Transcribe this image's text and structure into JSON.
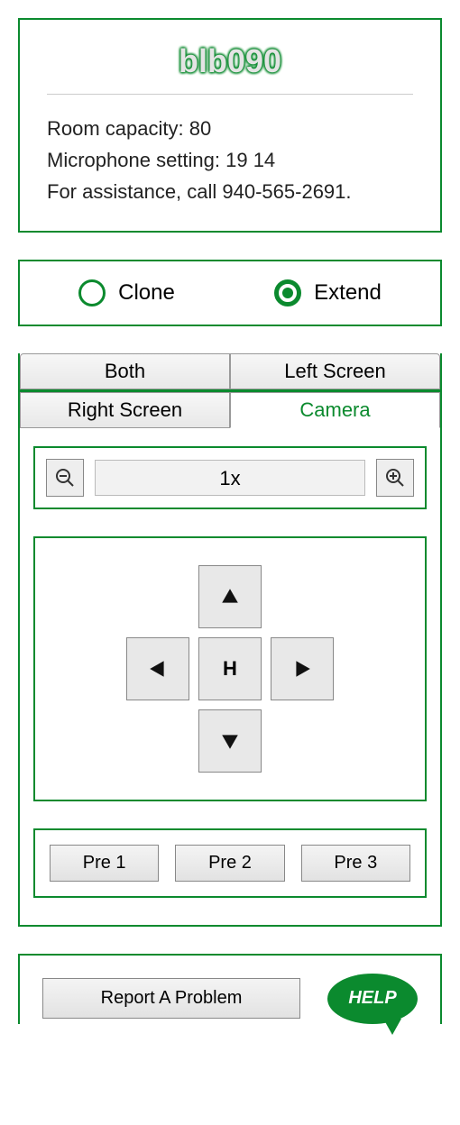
{
  "room": {
    "title": "blb090",
    "capacity_line": "Room capacity: 80",
    "mic_line": "Microphone setting: 19 14",
    "assist_line": "For assistance, call 940-565-2691."
  },
  "displayMode": {
    "clone": "Clone",
    "extend": "Extend",
    "selected": "extend"
  },
  "tabs": {
    "both": "Both",
    "left": "Left Screen",
    "right": "Right Screen",
    "camera": "Camera",
    "active": "camera"
  },
  "zoom": {
    "display": "1x"
  },
  "dpad": {
    "home": "H"
  },
  "presets": {
    "p1": "Pre 1",
    "p2": "Pre 2",
    "p3": "Pre 3"
  },
  "footer": {
    "report": "Report A Problem",
    "help": "HELP"
  }
}
